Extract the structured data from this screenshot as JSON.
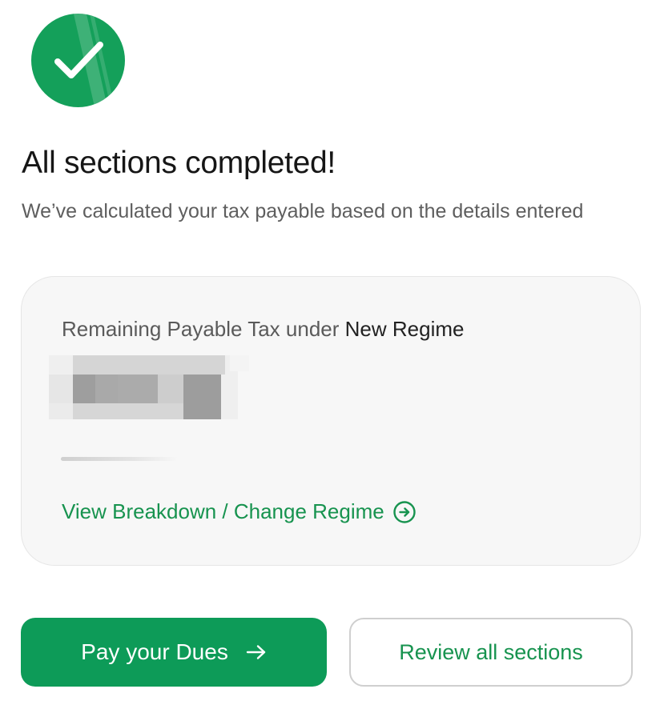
{
  "header": {
    "badge_icon": "checkmark-icon",
    "title": "All sections completed!",
    "subtitle": "We’ve calculated your tax payable based on the details entered"
  },
  "tax_card": {
    "label_prefix": "Remaining Payable Tax under ",
    "label_regime": "New Regime",
    "amount_visibility": "blurred",
    "breakdown_link": "View Breakdown / Change Regime",
    "breakdown_icon": "arrow-circle-right-icon"
  },
  "actions": {
    "pay_label": "Pay your Dues",
    "pay_icon": "arrow-right-icon",
    "review_label": "Review all sections"
  },
  "colors": {
    "brand_green": "#0d9b58",
    "link_green": "#17934f",
    "card_background": "#f7f7f7"
  }
}
